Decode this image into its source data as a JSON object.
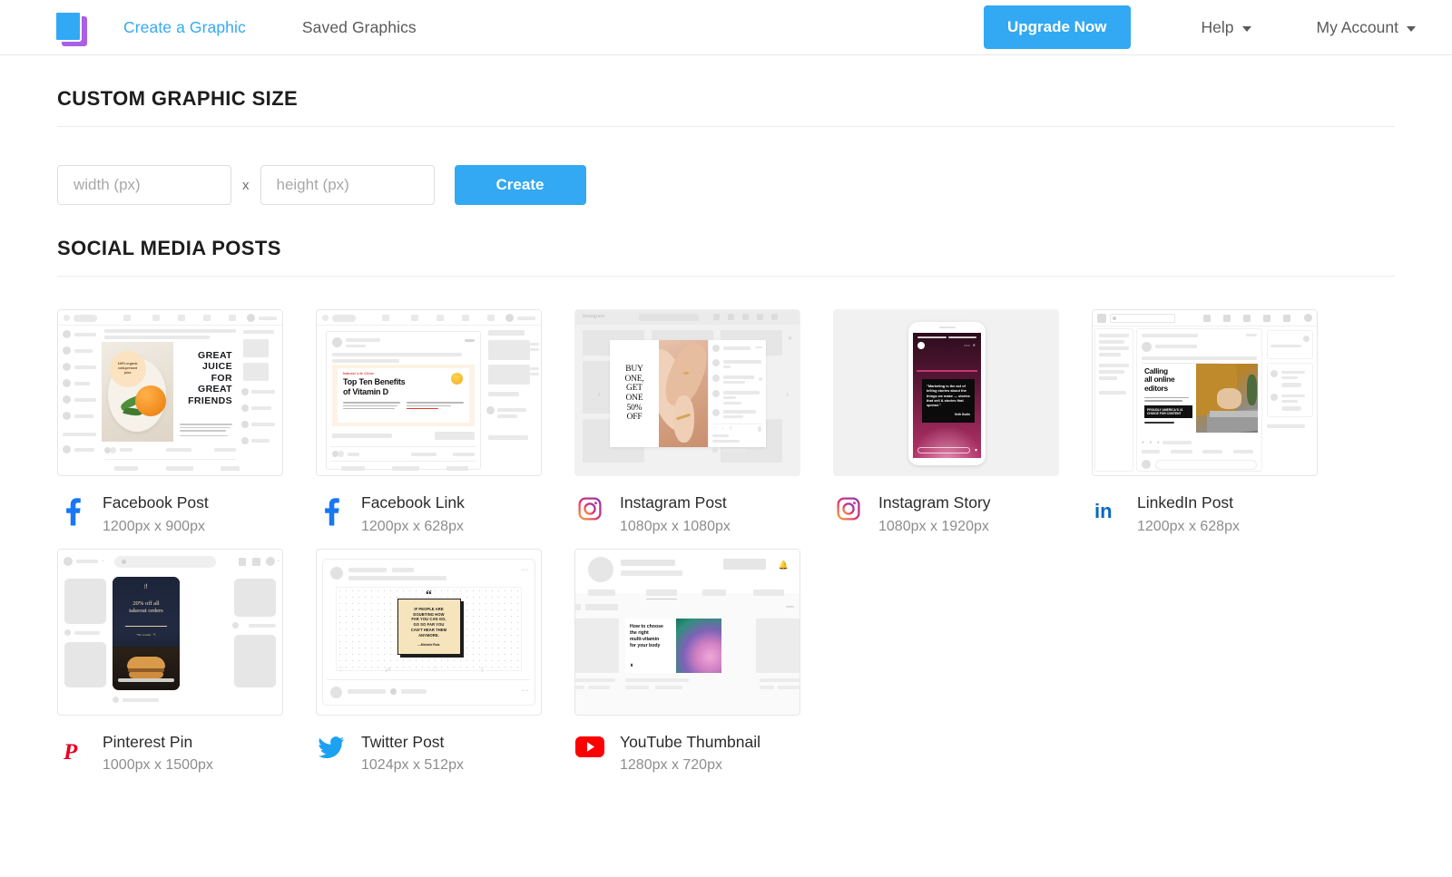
{
  "brand": {
    "logo_name": "stacked-squares-logo",
    "colors": {
      "accent": "#32a9f2",
      "logo_purple": "#a95fe8",
      "logo_blue": "#31a9f5"
    }
  },
  "header": {
    "nav": [
      {
        "label": "Create a Graphic",
        "active": true
      },
      {
        "label": "Saved Graphics",
        "active": false
      }
    ],
    "upgrade_label": "Upgrade Now",
    "help_label": "Help",
    "account_label": "My Account"
  },
  "custom_size": {
    "section_title": "CUSTOM GRAPHIC SIZE",
    "width_placeholder": "width (px)",
    "width_value": "",
    "height_placeholder": "height (px)",
    "height_value": "",
    "separator": "x",
    "create_label": "Create"
  },
  "social": {
    "section_title": "SOCIAL MEDIA POSTS",
    "cards": [
      {
        "title": "Facebook Post",
        "size": "1200px x 900px",
        "icon": "facebook-icon",
        "icon_color": "#1877f2"
      },
      {
        "title": "Facebook Link",
        "size": "1200px x 628px",
        "icon": "facebook-icon",
        "icon_color": "#1877f2"
      },
      {
        "title": "Instagram Post",
        "size": "1080px x 1080px",
        "icon": "instagram-icon",
        "icon_color": "#e1306c"
      },
      {
        "title": "Instagram Story",
        "size": "1080px x 1920px",
        "icon": "instagram-icon",
        "icon_color": "#e1306c"
      },
      {
        "title": "LinkedIn Post",
        "size": "1200px x 628px",
        "icon": "linkedin-icon",
        "icon_color": "#0a66c2"
      },
      {
        "title": "Pinterest Pin",
        "size": "1000px x 1500px",
        "icon": "pinterest-icon",
        "icon_color": "#e60023"
      },
      {
        "title": "Twitter Post",
        "size": "1024px x 512px",
        "icon": "twitter-icon",
        "icon_color": "#1da1f2"
      },
      {
        "title": "YouTube Thumbnail",
        "size": "1280px x 720px",
        "icon": "youtube-icon",
        "icon_color": "#ff0000"
      }
    ]
  },
  "thumbnails": {
    "facebook_post": {
      "headline": "GREAT JUICE FOR GREAT FRIENDS",
      "badge": "100% organic cold-pressed juice"
    },
    "facebook_link": {
      "kicker": "Natural Life Clinic",
      "headline": "Top Ten Benefits of Vitamin D"
    },
    "instagram_post": {
      "headline": "BUY ONE, GET ONE 50% OFF"
    },
    "instagram_story": {
      "quote": "\"Marketing is the act of telling stories about the things we make — stories that sell & stories that spread.\"",
      "attribution": "Seth Godin"
    },
    "linkedin_post": {
      "headline": "Calling all online editors",
      "banner": "PROUDLY AMERICA'S #1 CHOICE FOR CONTENT"
    },
    "pinterest_pin": {
      "headline": "20% off all takeout orders"
    },
    "twitter_post": {
      "quote": "IF PEOPLE ARE DOUBTING HOW FAR YOU CAN GO, GO SO FAR YOU CAN'T HEAR THEM ANYMORE.",
      "attribution": "—Michele Ruiz"
    },
    "youtube_thumbnail": {
      "headline": "How to choose the right multi-vitamin for your body"
    }
  }
}
